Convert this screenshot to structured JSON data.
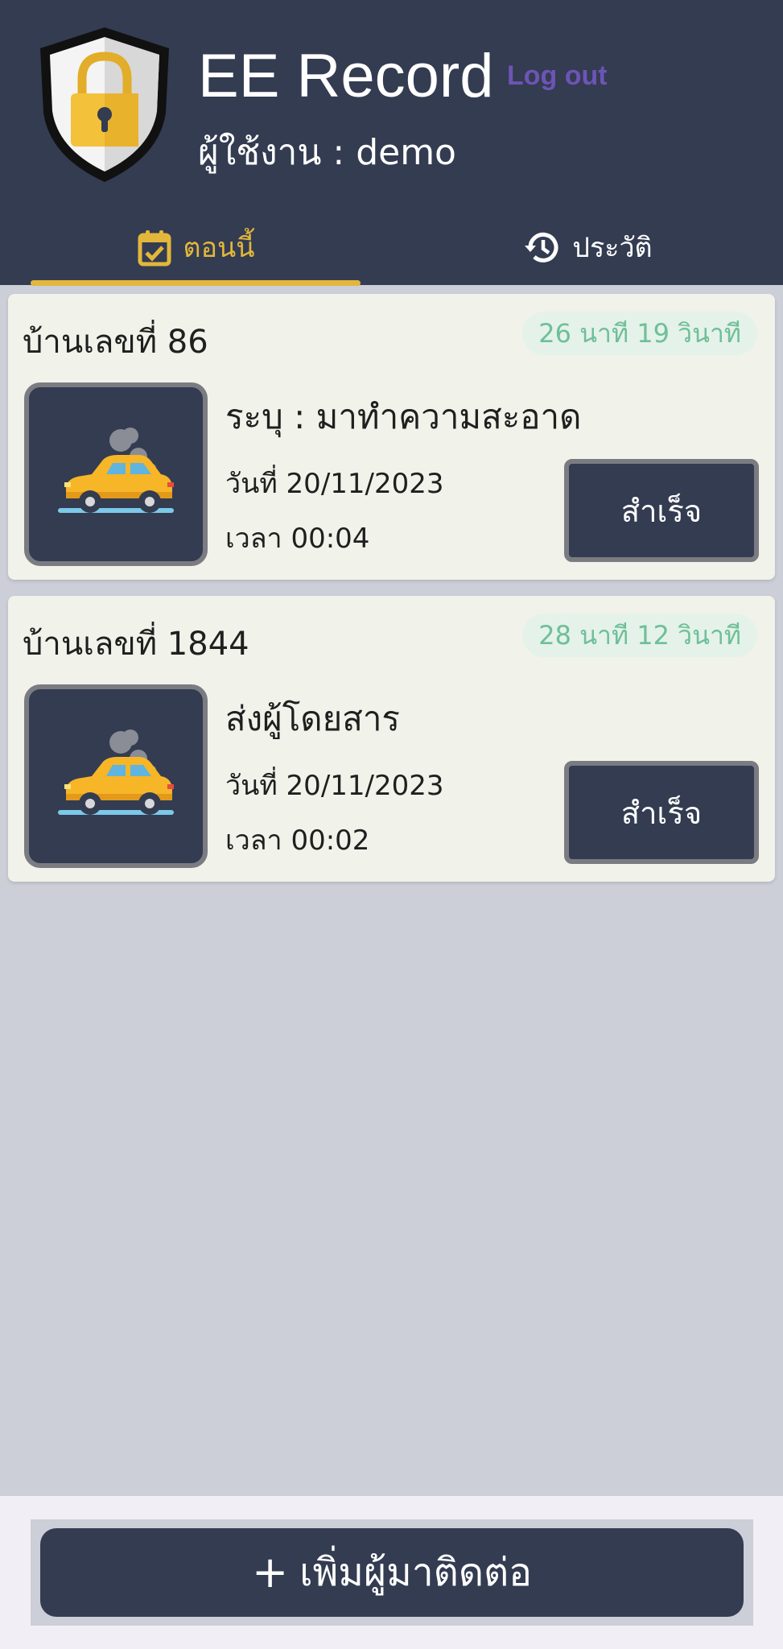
{
  "header": {
    "app_title": "EE Record",
    "logout_label": "Log out",
    "user_line": "ผู้ใช้งาน : demo"
  },
  "tabs": [
    {
      "label": "ตอนนี้",
      "icon": "calendar-check-icon",
      "active": true
    },
    {
      "label": "ประวัติ",
      "icon": "history-icon",
      "active": false
    }
  ],
  "records": [
    {
      "house": "บ้านเลขที่ 86",
      "duration": "26 นาที 19 วินาที",
      "description": "ระบุ : มาทำความสะอาด",
      "date": "วันที่ 20/11/2023",
      "time": "เวลา 00:04",
      "action_label": "สำเร็จ",
      "icon": "car-icon"
    },
    {
      "house": "บ้านเลขที่ 1844",
      "duration": "28 นาที 12 วินาที",
      "description": "ส่งผู้โดยสาร",
      "date": "วันที่ 20/11/2023",
      "time": "เวลา 00:02",
      "action_label": "สำเร็จ",
      "icon": "car-icon"
    }
  ],
  "footer": {
    "add_icon": "+",
    "add_label": "เพิ่มผู้มาติดต่อ"
  },
  "colors": {
    "header_bg": "#333c51",
    "accent": "#e3b73b",
    "logout": "#6d54b5",
    "duration_text": "#6fbf97",
    "card_bg": "#f1f2ea",
    "page_bg": "#ccced8"
  }
}
